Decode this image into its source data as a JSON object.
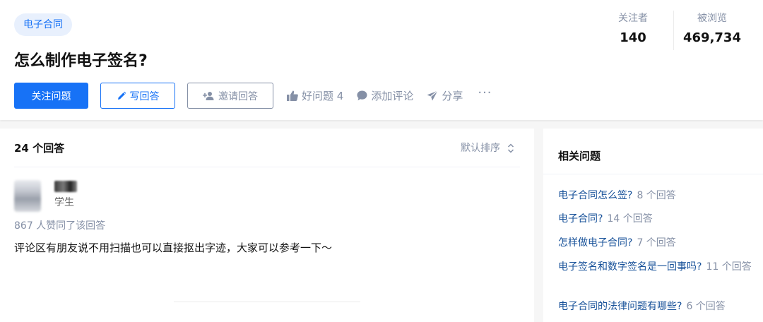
{
  "question": {
    "tag": "电子合同",
    "title": "怎么制作电子签名?",
    "actions": {
      "follow": "关注问题",
      "write": "写回答",
      "invite": "邀请回答",
      "good": "好问题 4",
      "comment": "添加评论",
      "share": "分享",
      "more": "···"
    },
    "stats": {
      "followers_label": "关注者",
      "followers": "140",
      "views_label": "被浏览",
      "views": "469,734"
    }
  },
  "answers": {
    "count_label": "24 个回答",
    "sort_label": "默认排序",
    "first": {
      "author_bio": "学生",
      "votes": "867 人赞同了该回答",
      "content": "评论区有朋友说不用扫描也可以直接抠出字迹，大家可以参考一下～"
    }
  },
  "related": {
    "title": "相关问题",
    "items": [
      {
        "q": "电子合同怎么签?",
        "c": "8 个回答"
      },
      {
        "q": "电子合同?",
        "c": "14 个回答"
      },
      {
        "q": "怎样做电子合同?",
        "c": "7 个回答"
      },
      {
        "q": "电子签名和数字签名是一回事吗?",
        "c": "11 个回答"
      },
      {
        "q": "电子合同的法律问题有哪些?",
        "c": "6 个回答"
      }
    ]
  },
  "colors": {
    "brand": "#1772f6",
    "muted": "#8590a6",
    "link": "#175199"
  }
}
